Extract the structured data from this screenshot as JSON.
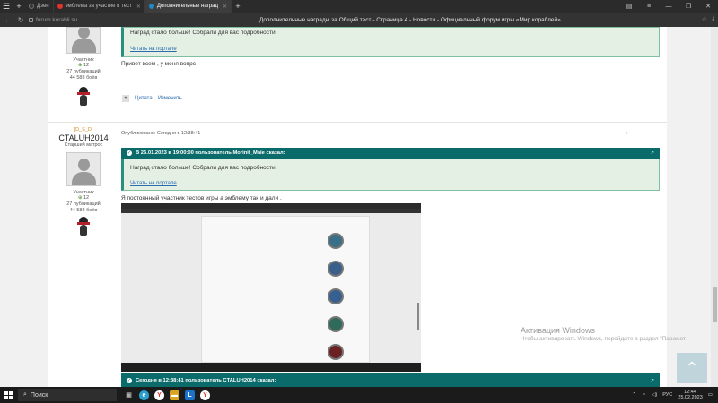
{
  "browser": {
    "tabs": [
      {
        "label": "Дзен",
        "color": "#333333"
      },
      {
        "label": "эмблема за участие в тест",
        "color": "#e0332b"
      },
      {
        "label": "Дополнительные наград",
        "color": "#1e88c8"
      }
    ],
    "url": "forum.korabli.su",
    "page_title": "Дополнительные награды за Общий тест - Страница 4 - Новости - Официальный форум игры «Мир кораблей»"
  },
  "post1": {
    "role": "Участник",
    "reputation": "12",
    "publications": "27 публикаций",
    "battles": "44 588 боёв",
    "quote_text": "Наград стало больше! Собрали для вас подробности.",
    "quote_link": "Читать на портале",
    "message": "Привет всем , у меня вопрс",
    "action_quote": "Цитата",
    "action_edit": "Изменить"
  },
  "post2": {
    "clan": "[D_S_D]",
    "author": "CTALUH2014",
    "rank": "Старший матрос",
    "role": "Участник",
    "reputation": "12",
    "publications": "27 публикаций",
    "battles": "44 588 боёв",
    "published": "Опубликовано: Сегодня в 12:38:41",
    "quote_header": "В 26.01.2023 в 19:00:00 пользователь Morinit_Maie сказал:",
    "quote_text": "Наград стало больше! Собрали для вас подробности.",
    "quote_link": "Читать на портале",
    "message": "Я постоянный участник тестов игры а эмблему так и дали ."
  },
  "post3": {
    "quote_header": "Сегодня в 12:38:41 пользователь CTALUH2014 сказал:"
  },
  "embedded": {
    "medal_colors": [
      "#3a6f8a",
      "#3a5f8a",
      "#35608f",
      "#2f6a5a",
      "#6a2222"
    ]
  },
  "watermark": {
    "title": "Активация Windows",
    "subtitle": "Чтобы активировать Windows, перейдите в раздел \"Парамет"
  },
  "taskbar": {
    "search_label": "Поиск",
    "lang": "РУС",
    "time": "12:44",
    "date": "25.02.2023"
  }
}
